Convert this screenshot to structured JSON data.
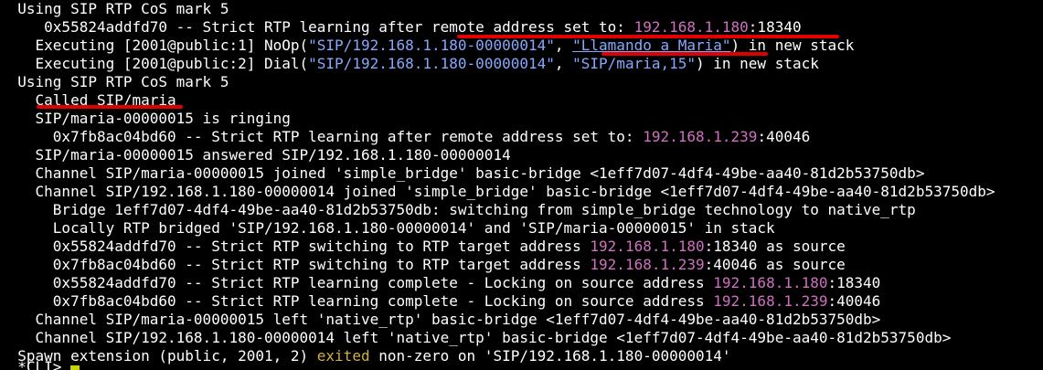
{
  "terminal": {
    "lines": [
      {
        "segments": [
          {
            "t": "  Using SIP RTP CoS mark 5"
          }
        ]
      },
      {
        "segments": [
          {
            "t": "     0x55824addfd70 -- Strict RTP learning after remote address set to: "
          },
          {
            "t": "192.168.1.180",
            "c": "ip"
          },
          {
            "t": ":18340"
          }
        ]
      },
      {
        "segments": [
          {
            "t": "    Executing [2001@public:1] NoOp("
          },
          {
            "t": "\"SIP/192.168.1.180-00000014\"",
            "c": "blue"
          },
          {
            "t": ", "
          },
          {
            "t": "\"Llamando a Maria\"",
            "c": "blue u"
          },
          {
            "t": ") in new stack"
          }
        ]
      },
      {
        "segments": [
          {
            "t": "    Executing [2001@public:2] Dial("
          },
          {
            "t": "\"SIP/192.168.1.180-00000014\"",
            "c": "blue"
          },
          {
            "t": ", "
          },
          {
            "t": "\"SIP/maria,15\"",
            "c": "blue"
          },
          {
            "t": ") in new stack"
          }
        ]
      },
      {
        "segments": [
          {
            "t": "  Using SIP RTP CoS mark 5"
          }
        ]
      },
      {
        "segments": [
          {
            "t": "    Called SIP/maria"
          }
        ]
      },
      {
        "segments": [
          {
            "t": "    SIP/maria-00000015 is ringing"
          }
        ]
      },
      {
        "segments": [
          {
            "t": "      0x7fb8ac04bd60 -- Strict RTP learning after remote address set to: "
          },
          {
            "t": "192.168.1.239",
            "c": "ip"
          },
          {
            "t": ":40046"
          }
        ]
      },
      {
        "segments": [
          {
            "t": "    SIP/maria-00000015 answered SIP/192.168.1.180-00000014"
          }
        ]
      },
      {
        "segments": [
          {
            "t": "    Channel SIP/maria-00000015 joined 'simple_bridge' basic-bridge <1eff7d07-4df4-49be-aa40-81d2b53750db>"
          }
        ]
      },
      {
        "segments": [
          {
            "t": "    Channel SIP/192.168.1.180-00000014 joined 'simple_bridge' basic-bridge <1eff7d07-4df4-49be-aa40-81d2b53750db>"
          }
        ]
      },
      {
        "segments": [
          {
            "t": "      Bridge 1eff7d07-4df4-49be-aa40-81d2b53750db: switching from simple_bridge technology to native_rtp"
          }
        ]
      },
      {
        "segments": [
          {
            "t": "      Locally RTP bridged 'SIP/192.168.1.180-00000014' and 'SIP/maria-00000015' in stack"
          }
        ]
      },
      {
        "segments": [
          {
            "t": "      0x55824addfd70 -- Strict RTP switching to RTP target address "
          },
          {
            "t": "192.168.1.180",
            "c": "ip"
          },
          {
            "t": ":18340 as source"
          }
        ]
      },
      {
        "segments": [
          {
            "t": "      0x7fb8ac04bd60 -- Strict RTP switching to RTP target address "
          },
          {
            "t": "192.168.1.239",
            "c": "ip"
          },
          {
            "t": ":40046 as source"
          }
        ]
      },
      {
        "segments": [
          {
            "t": "      0x55824addfd70 -- Strict RTP learning complete - Locking on source address "
          },
          {
            "t": "192.168.1.180",
            "c": "ip"
          },
          {
            "t": ":18340"
          }
        ]
      },
      {
        "segments": [
          {
            "t": "      0x7fb8ac04bd60 -- Strict RTP learning complete - Locking on source address "
          },
          {
            "t": "192.168.1.239",
            "c": "ip"
          },
          {
            "t": ":40046"
          }
        ]
      },
      {
        "segments": [
          {
            "t": "    Channel SIP/maria-00000015 left 'native_rtp' basic-bridge <1eff7d07-4df4-49be-aa40-81d2b53750db>"
          }
        ]
      },
      {
        "segments": [
          {
            "t": "    Channel SIP/192.168.1.180-00000014 left 'native_rtp' basic-bridge <1eff7d07-4df4-49be-aa40-81d2b53750db>"
          }
        ]
      },
      {
        "segments": [
          {
            "t": "  Spawn extension (public, 2001, 2) "
          },
          {
            "t": "exited",
            "c": "yellow"
          },
          {
            "t": " non-zero on 'SIP/192.168.1.180-00000014'"
          }
        ]
      }
    ],
    "prompt": "  *CLI> "
  },
  "colors": {
    "background": "#000000",
    "text": "#ffffff",
    "ip": "#d070c0",
    "string": "#88a8ff",
    "exited": "#d0b040",
    "annotation": "#e00000",
    "cursor": "#c8d400"
  }
}
